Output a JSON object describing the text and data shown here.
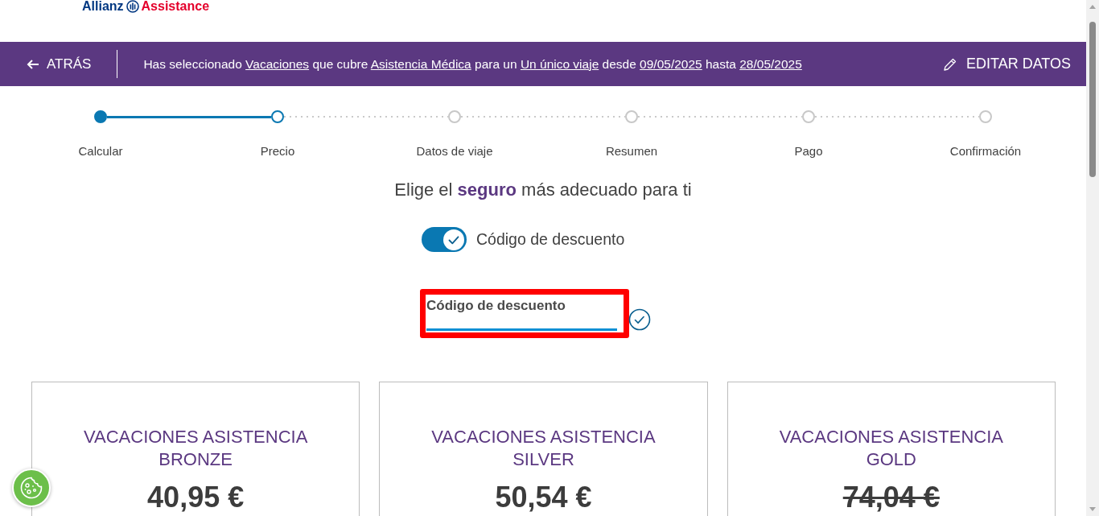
{
  "logo": {
    "brand": "Allianz",
    "product": "Assistance"
  },
  "top_bar": {
    "back_label": "ATRÁS",
    "summary": [
      {
        "kind": "text",
        "text": "Has seleccionado "
      },
      {
        "kind": "link",
        "text": "Vacaciones"
      },
      {
        "kind": "text",
        "text": " que cubre "
      },
      {
        "kind": "link",
        "text": "Asistencia Médica"
      },
      {
        "kind": "text",
        "text": " para un "
      },
      {
        "kind": "link",
        "text": "Un único viaje"
      },
      {
        "kind": "text",
        "text": " desde "
      },
      {
        "kind": "link",
        "text": "09/05/2025"
      },
      {
        "kind": "text",
        "text": " hasta "
      },
      {
        "kind": "link",
        "text": "28/05/2025"
      }
    ],
    "edit_label": "EDITAR DATOS"
  },
  "stepper": [
    {
      "label": "Calcular",
      "completed": true,
      "selected": false
    },
    {
      "label": "Precio",
      "completed": false,
      "selected": true
    },
    {
      "label": "Datos de viaje",
      "completed": false,
      "selected": false
    },
    {
      "label": "Resumen",
      "completed": false,
      "selected": false
    },
    {
      "label": "Pago",
      "completed": false,
      "selected": false
    },
    {
      "label": "Confirmación",
      "completed": false,
      "selected": false
    }
  ],
  "heading": "Elige el **seguro** más adecuado para ti",
  "discount_toggle": {
    "label": "Código de descuento",
    "on": true
  },
  "discount_field": {
    "label": "Código de descuento",
    "focused": true,
    "highlighted": true
  },
  "plans": [
    {
      "name": "VACACIONES ASISTENCIA BRONZE",
      "price": "40,95 €",
      "struck": false
    },
    {
      "name": "VACACIONES ASISTENCIA SILVER",
      "price": "50,54 €",
      "struck": false
    },
    {
      "name": "VACACIONES ASISTENCIA GOLD",
      "price": "74,04 €",
      "struck": true
    }
  ]
}
